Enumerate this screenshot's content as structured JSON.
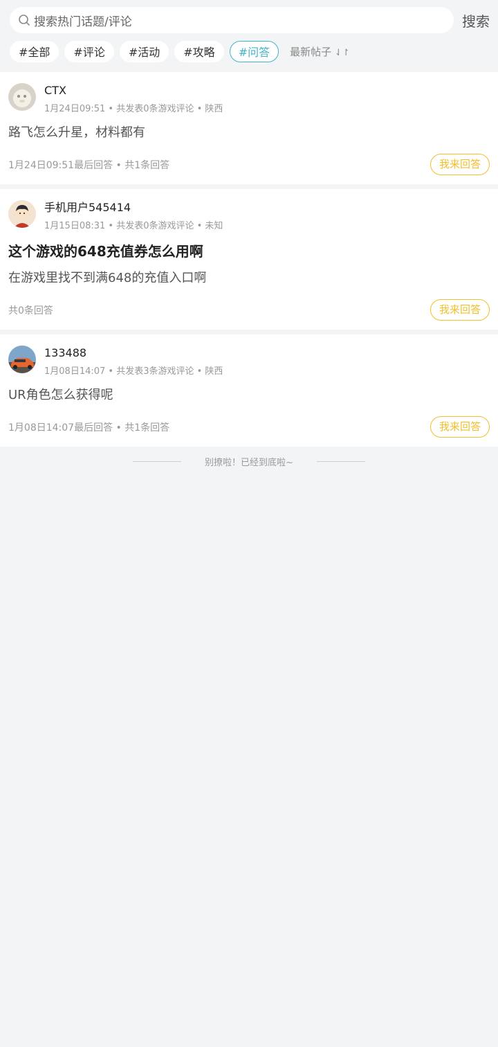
{
  "search": {
    "placeholder": "搜索热门话题/评论",
    "button": "搜索"
  },
  "tags": [
    "#全部",
    "#评论",
    "#活动",
    "#攻略",
    "#问答"
  ],
  "active_tag": "#问答",
  "sort": {
    "label": "最新帖子",
    "arrow": "⇃↾"
  },
  "posts": [
    {
      "username": "CTX",
      "meta": "1月24日09:51 • 共发表0条游戏评论 • 陕西",
      "title": "",
      "content": "路飞怎么升星，材料都有",
      "footer": "1月24日09:51最后回答 • 共1条回答",
      "answer_btn": "我来回答"
    },
    {
      "username": "手机用户545414",
      "meta": "1月15日08:31 • 共发表0条游戏评论 • 未知",
      "title": "这个游戏的648充值券怎么用啊",
      "content": "在游戏里找不到满648的充值入口啊",
      "footer": "共0条回答",
      "answer_btn": "我来回答"
    },
    {
      "username": "133488",
      "meta": "1月08日14:07 • 共发表3条游戏评论 • 陕西",
      "title": "",
      "content": "UR角色怎么获得呢",
      "footer": "1月08日14:07最后回答 • 共1条回答",
      "answer_btn": "我来回答"
    }
  ],
  "end_text": "别撩啦！已经到底啦~",
  "colors": {
    "accent_teal": "#42b4c8",
    "accent_yellow": "#f0bf2c",
    "background": "#f3f4f6"
  }
}
